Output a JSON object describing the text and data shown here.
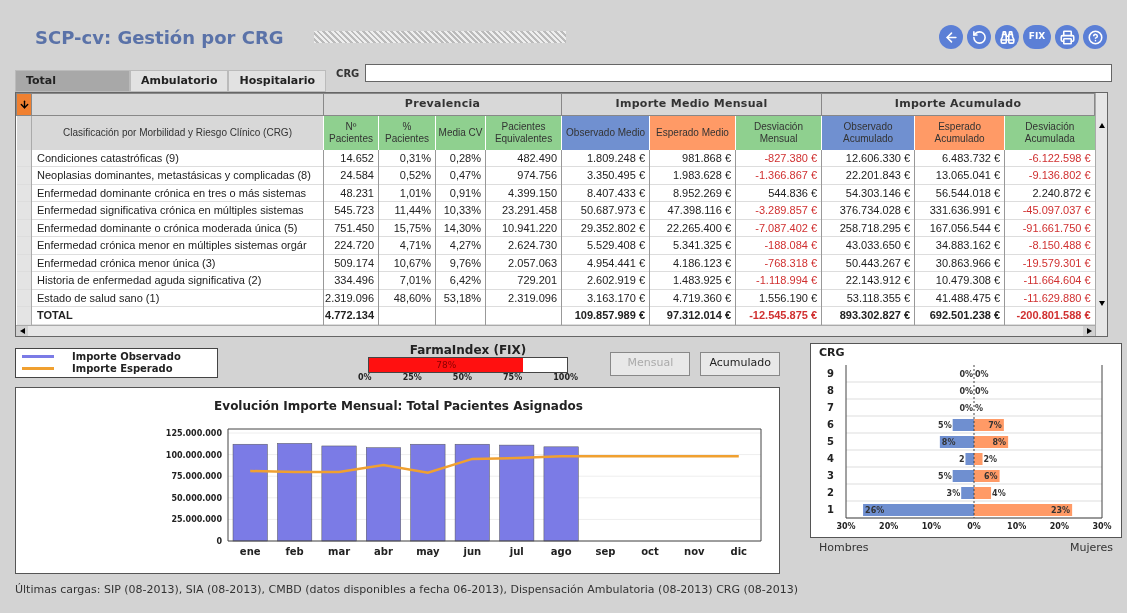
{
  "window": {
    "title": "SCP-cv: Gestión por CRG"
  },
  "toolbar": [
    {
      "kind": "back"
    },
    {
      "kind": "refresh"
    },
    {
      "kind": "binoculars"
    },
    {
      "kind": "text",
      "label": "FIX"
    },
    {
      "kind": "print"
    },
    {
      "kind": "help"
    }
  ],
  "tabs": [
    {
      "label": "Total",
      "selected": true
    },
    {
      "label": "Ambulatorio",
      "selected": false
    },
    {
      "label": "Hospitalario",
      "selected": false
    }
  ],
  "crg_field": {
    "label": "CRG"
  },
  "table": {
    "label_column": "Clasificación por Morbilidad y Riesgo Clínico (CRG)",
    "groups": [
      {
        "label": "Prevalencia",
        "columns": [
          {
            "label": "Nº Pacientes",
            "color": "#8fd08f"
          },
          {
            "label": "% Pacientes",
            "color": "#8fd08f"
          },
          {
            "label": "Media CV",
            "color": "#8fd08f"
          },
          {
            "label": "Pacientes Equivalentes",
            "color": "#8fd08f"
          }
        ]
      },
      {
        "label": "Importe Medio Mensual",
        "columns": [
          {
            "label": "Observado Medio",
            "color": "#7090d0"
          },
          {
            "label": "Esperado Medio",
            "color": "#ff9a66"
          },
          {
            "label": "Desviación Mensual",
            "color": "#8fd08f"
          }
        ]
      },
      {
        "label": "Importe Acumulado",
        "columns": [
          {
            "label": "Observado Acumulado",
            "color": "#7090d0"
          },
          {
            "label": "Esperado Acumulado",
            "color": "#ff9a66"
          },
          {
            "label": "Desviación Acumulada",
            "color": "#8fd08f"
          }
        ]
      }
    ],
    "rows": [
      {
        "kind": "item",
        "label": "Condiciones catastróficas (9)",
        "cells": [
          "14.652",
          "0,31%",
          "0,28%",
          "482.490",
          "1.809.248 €",
          "981.868 €",
          {
            "value": "-827.380 €",
            "negative": true
          },
          "12.606.330 €",
          "6.483.732 €",
          {
            "value": "-6.122.598 €",
            "negative": true
          }
        ]
      },
      {
        "kind": "item",
        "label": "Neoplasias dominantes, metastásicas y complicadas (8)",
        "cells": [
          "24.584",
          "0,52%",
          "0,47%",
          "974.756",
          "3.350.495 €",
          "1.983.628 €",
          {
            "value": "-1.366.867 €",
            "negative": true
          },
          "22.201.843 €",
          "13.065.041 €",
          {
            "value": "-9.136.802 €",
            "negative": true
          }
        ]
      },
      {
        "kind": "item",
        "label": "Enfermedad dominante crónica en tres o más sistemas",
        "cells": [
          "48.231",
          "1,01%",
          "0,91%",
          "4.399.150",
          "8.407.433 €",
          "8.952.269 €",
          {
            "value": "544.836 €",
            "negative": false
          },
          "54.303.146 €",
          "56.544.018 €",
          {
            "value": "2.240.872 €",
            "negative": false
          }
        ]
      },
      {
        "kind": "item",
        "label": "Enfermedad significativa crónica en múltiples sistemas",
        "cells": [
          "545.723",
          "11,44%",
          "10,33%",
          "23.291.458",
          "50.687.973 €",
          "47.398.116 €",
          {
            "value": "-3.289.857 €",
            "negative": true
          },
          "376.734.028 €",
          "331.636.991 €",
          {
            "value": "-45.097.037 €",
            "negative": true
          }
        ]
      },
      {
        "kind": "item",
        "label": "Enfermedad dominante o crónica moderada única (5)",
        "cells": [
          "751.450",
          "15,75%",
          "14,30%",
          "10.941.220",
          "29.352.802 €",
          "22.265.400 €",
          {
            "value": "-7.087.402 €",
            "negative": true
          },
          "258.718.295 €",
          "167.056.544 €",
          {
            "value": "-91.661.750 €",
            "negative": true
          }
        ]
      },
      {
        "kind": "item",
        "label": "Enfermedad crónica menor en múltiples sistemas orgár",
        "cells": [
          "224.720",
          "4,71%",
          "4,27%",
          "2.624.730",
          "5.529.408 €",
          "5.341.325 €",
          {
            "value": "-188.084 €",
            "negative": true
          },
          "43.033.650 €",
          "34.883.162 €",
          {
            "value": "-8.150.488 €",
            "negative": true
          }
        ]
      },
      {
        "kind": "item",
        "label": "Enfermedad crónica menor única (3)",
        "cells": [
          "509.174",
          "10,67%",
          "9,76%",
          "2.057.063",
          "4.954.441 €",
          "4.186.123 €",
          {
            "value": "-768.318 €",
            "negative": true
          },
          "50.443.267 €",
          "30.863.966 €",
          {
            "value": "-19.579.301 €",
            "negative": true
          }
        ]
      },
      {
        "kind": "item",
        "label": "Historia de enfermedad aguda significativa (2)",
        "cells": [
          "334.496",
          "7,01%",
          "6,42%",
          "729.201",
          "2.602.919 €",
          "1.483.925 €",
          {
            "value": "-1.118.994 €",
            "negative": true
          },
          "22.143.912 €",
          "10.479.308 €",
          {
            "value": "-11.664.604 €",
            "negative": true
          }
        ]
      },
      {
        "kind": "item",
        "label": "Estado de salud sano (1)",
        "cells": [
          "2.319.096",
          "48,60%",
          "53,18%",
          "2.319.096",
          "3.163.170 €",
          "4.719.360 €",
          {
            "value": "1.556.190 €",
            "negative": false
          },
          "53.118.355 €",
          "41.488.475 €",
          {
            "value": "-11.629.880 €",
            "negative": true
          }
        ]
      },
      {
        "kind": "total",
        "label": "TOTAL",
        "cells": [
          "4.772.134",
          "",
          "",
          "",
          "109.857.989 €",
          "97.312.014 €",
          {
            "value": "-12.545.875 €",
            "negative": true
          },
          "893.302.827 €",
          "692.501.238 €",
          {
            "value": "-200.801.588 €",
            "negative": true
          }
        ]
      }
    ]
  },
  "farmaindex": {
    "title": "FarmaIndex (FIX)",
    "level": 0.78,
    "label": "78%",
    "ticks": [
      "0%",
      "25%",
      "50%",
      "75%",
      "100%"
    ]
  },
  "buttons": [
    {
      "label": "Mensual",
      "disabled": true
    },
    {
      "label": "Acumulado",
      "disabled": false
    }
  ],
  "monthly_chart": {
    "chart_data": {
      "type": "bar",
      "grid": true,
      "title": "Evolución Importe Mensual: Total Pacientes Asignados",
      "categories": [
        "ene",
        "feb",
        "mar",
        "abr",
        "may",
        "jun",
        "jul",
        "ago",
        "sep",
        "oct",
        "nov",
        "dic"
      ],
      "series": [
        {
          "name": "Importe Observado",
          "type": "bar",
          "color": "#7b7be6",
          "values": [
            112000000,
            113000000,
            110000000,
            108000000,
            112000000,
            112000000,
            111000000,
            109000000,
            null,
            null,
            null,
            null
          ]
        },
        {
          "name": "Importe Esperado",
          "type": "line",
          "color": "#f0a030",
          "values": [
            81000000,
            80000000,
            80000000,
            88000000,
            79000000,
            95000000,
            96000000,
            98000000,
            98000000,
            98000000,
            98000000,
            98000000
          ]
        }
      ],
      "ylim": [
        0,
        125000000
      ],
      "yticks": [
        {
          "value": 0,
          "label": "0"
        },
        {
          "value": 25000000,
          "label": "25.000.000"
        },
        {
          "value": 50000000,
          "label": "50.000.000"
        },
        {
          "value": 75000000,
          "label": "75.000.000"
        },
        {
          "value": 100000000,
          "label": "100.000.000"
        },
        {
          "value": 125000000,
          "label": "125.000.000"
        }
      ]
    }
  },
  "pyramid": {
    "chart_data": {
      "type": "bar",
      "orientation": "horizontal",
      "grid": true,
      "stacked": true,
      "ref_lines": [
        {
          "axis": "x",
          "value": 0
        }
      ],
      "ylabel": "CRG",
      "categories": [
        "9",
        "8",
        "7",
        "6",
        "5",
        "4",
        "3",
        "2",
        "1"
      ],
      "series": [
        {
          "name": "Hombres",
          "color": "#6f8fd0",
          "values": [
            0,
            0,
            0,
            -5,
            -8,
            -2,
            -5,
            -3,
            -26
          ]
        },
        {
          "name": "Mujeres",
          "color": "#ff9a66",
          "values": [
            0,
            0,
            0,
            7,
            8,
            2,
            6,
            4,
            23
          ]
        }
      ],
      "value_labels": [
        [
          "0%",
          "0%",
          "0%",
          "5%",
          "8%",
          "2",
          "5%",
          "3%",
          "26%"
        ],
        [
          "0%",
          "0%",
          "%",
          "7%",
          "8%",
          "2%",
          "6%",
          "4%",
          "23%"
        ]
      ],
      "xlim": [
        -30,
        30
      ],
      "xticks": [
        {
          "value": -30,
          "label": "30%"
        },
        {
          "value": -20,
          "label": "20%"
        },
        {
          "value": -10,
          "label": "10%"
        },
        {
          "value": 0,
          "label": "0%"
        },
        {
          "value": 10,
          "label": "10%"
        },
        {
          "value": 20,
          "label": "20%"
        },
        {
          "value": 30,
          "label": "30%"
        }
      ]
    }
  },
  "status_bar": "Últimas cargas: SIP (08-2013), SIA (08-2013), CMBD (datos disponibles a fecha 06-2013), Dispensación Ambulatoria (08-2013) CRG (08-2013)"
}
